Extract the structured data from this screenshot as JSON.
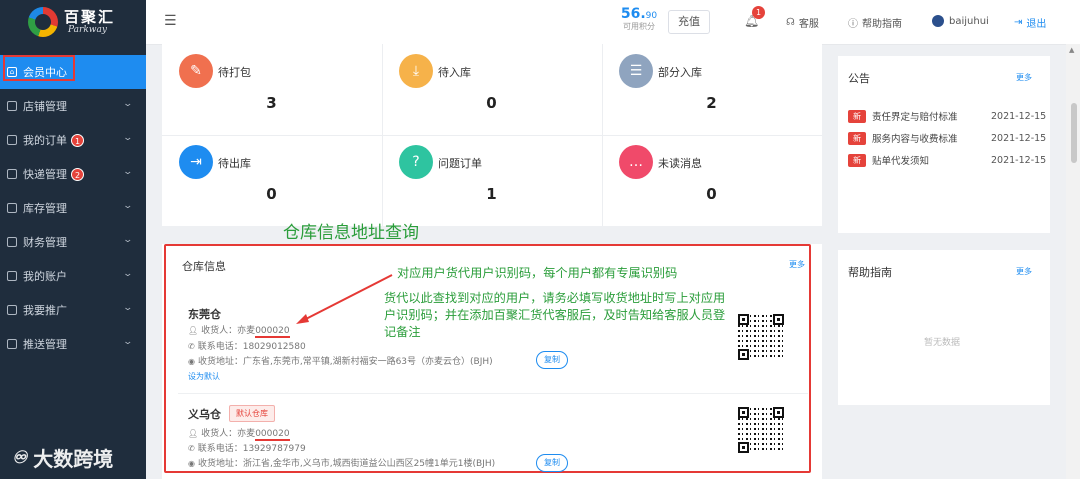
{
  "brand": {
    "title": "百聚汇",
    "subtitle": "Parkway"
  },
  "sidebar": {
    "items": [
      {
        "label": "会员中心",
        "icon": "home-icon",
        "active": true
      },
      {
        "label": "店铺管理",
        "icon": "store-icon"
      },
      {
        "label": "我的订单",
        "icon": "order-icon",
        "badge": "1"
      },
      {
        "label": "快递管理",
        "icon": "package-icon",
        "badge": "2"
      },
      {
        "label": "库存管理",
        "icon": "inventory-icon"
      },
      {
        "label": "财务管理",
        "icon": "finance-icon"
      },
      {
        "label": "我的账户",
        "icon": "account-icon"
      },
      {
        "label": "我要推广",
        "icon": "promote-icon"
      },
      {
        "label": "推送管理",
        "icon": "push-icon"
      }
    ]
  },
  "watermark": {
    "text": "大数跨境"
  },
  "topbar": {
    "points_int": "56.",
    "points_dec": "90",
    "points_label": "可用积分",
    "recharge_label": "充值",
    "notification_count": "1",
    "service_label": "客服",
    "help_label": "帮助指南",
    "username": "baijuhui",
    "logout_label": "退出"
  },
  "stats": [
    {
      "label": "待打包",
      "value": "3",
      "color": "#f0704f",
      "icon": "edit-icon"
    },
    {
      "label": "待入库",
      "value": "0",
      "color": "#f6b24a",
      "icon": "download-icon"
    },
    {
      "label": "部分入库",
      "value": "2",
      "color": "#8fa4bf",
      "icon": "list-icon"
    },
    {
      "label": "待出库",
      "value": "0",
      "color": "#1e8cf0",
      "icon": "export-icon"
    },
    {
      "label": "问题订单",
      "value": "1",
      "color": "#2ec4a0",
      "icon": "question-doc-icon"
    },
    {
      "label": "未读消息",
      "value": "0",
      "color": "#f04a6a",
      "icon": "message-icon"
    }
  ],
  "annotations": {
    "title": "仓库信息地址查询",
    "callout1": "对应用户货代用户识别码，每个用户都有专属识别码",
    "callout2": "货代以此查找到对应的用户，请务必填写收货地址时写上对应用户识别码；并在添加百聚汇货代客服后，及时告知给客服人员登记备注"
  },
  "warehouse": {
    "title": "仓库信息",
    "more": "更多",
    "list": [
      {
        "name": "东莞仓",
        "receiver_label": "收货人：",
        "receiver_name": "亦麦",
        "receiver_code": "000020",
        "phone_label": "联系电话：",
        "phone": "18029012580",
        "address_label": "收货地址：",
        "address": "广东省,东莞市,常平镇,湖新村福安一路63号（亦麦云仓）(BJH)",
        "copy_label": "复制",
        "set_default": "设为默认"
      },
      {
        "name": "义乌仓",
        "tag": "默认仓库",
        "receiver_label": "收货人：",
        "receiver_name": "亦麦",
        "receiver_code": "000020",
        "phone_label": "联系电话：",
        "phone": "13929787979",
        "address_label": "收货地址：",
        "address": "浙江省,金华市,义乌市,城西街道益公山西区25幢1单元1楼(BJH)",
        "copy_label": "复制"
      }
    ]
  },
  "notice": {
    "title": "公告",
    "more": "更多",
    "items": [
      {
        "tag": "新",
        "text": "责任界定与赔付标准",
        "date": "2021-12-15"
      },
      {
        "tag": "新",
        "text": "服务内容与收费标准",
        "date": "2021-12-15"
      },
      {
        "tag": "新",
        "text": "贴单代发须知",
        "date": "2021-12-15"
      }
    ]
  },
  "help": {
    "title": "帮助指南",
    "more": "更多",
    "empty": "暂无数据"
  }
}
